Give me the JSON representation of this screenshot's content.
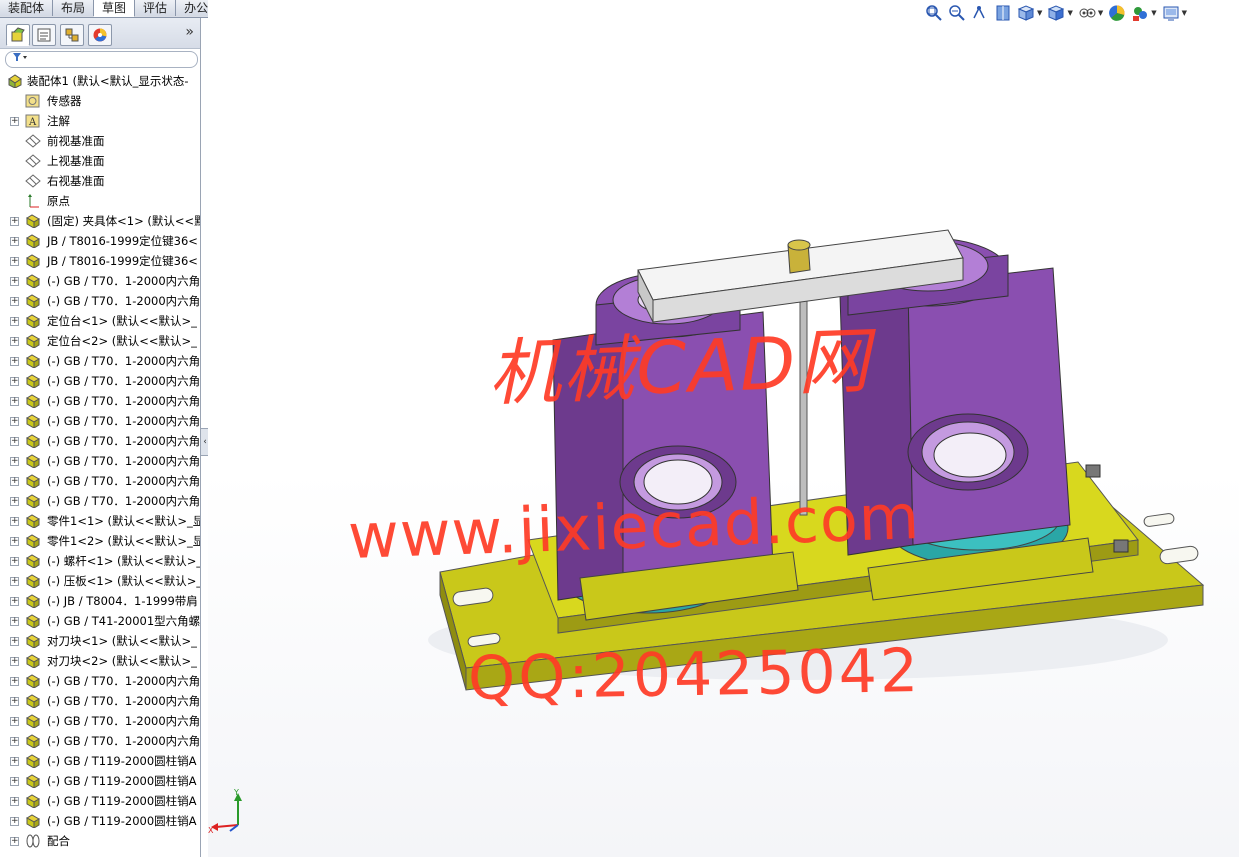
{
  "command_tabs": [
    {
      "label": "装配体",
      "active": false
    },
    {
      "label": "布局",
      "active": false
    },
    {
      "label": "草图",
      "active": true
    },
    {
      "label": "评估",
      "active": false
    },
    {
      "label": "办公室产品",
      "active": false
    }
  ],
  "panel": {
    "more_label": "»",
    "filter_icon": "filter-icon",
    "collapse_label": "‹"
  },
  "tree": {
    "root": "装配体1 (默认<默认_显示状态-",
    "items": [
      {
        "label": "传感器",
        "icon": "sensor-icon",
        "expandable": false
      },
      {
        "label": "注解",
        "icon": "annotation-icon",
        "expandable": true
      },
      {
        "label": "前视基准面",
        "icon": "plane-icon",
        "expandable": false
      },
      {
        "label": "上视基准面",
        "icon": "plane-icon",
        "expandable": false
      },
      {
        "label": "右视基准面",
        "icon": "plane-icon",
        "expandable": false
      },
      {
        "label": "原点",
        "icon": "origin-icon",
        "expandable": false
      },
      {
        "label": "(固定) 夹具体<1> (默认<<默",
        "icon": "part-icon",
        "expandable": true
      },
      {
        "label": "JB / T8016-1999定位键36<",
        "icon": "part-icon",
        "expandable": true
      },
      {
        "label": "JB / T8016-1999定位键36<",
        "icon": "part-icon",
        "expandable": true
      },
      {
        "label": "(-) GB / T70．1-2000内六角",
        "icon": "part-icon",
        "expandable": true
      },
      {
        "label": "(-) GB / T70．1-2000内六角",
        "icon": "part-icon",
        "expandable": true
      },
      {
        "label": "定位台<1> (默认<<默认>_",
        "icon": "part-icon",
        "expandable": true
      },
      {
        "label": "定位台<2> (默认<<默认>_",
        "icon": "part-icon",
        "expandable": true
      },
      {
        "label": "(-) GB / T70．1-2000内六角",
        "icon": "part-icon",
        "expandable": true
      },
      {
        "label": "(-) GB / T70．1-2000内六角",
        "icon": "part-icon",
        "expandable": true
      },
      {
        "label": "(-) GB / T70．1-2000内六角",
        "icon": "part-icon",
        "expandable": true
      },
      {
        "label": "(-) GB / T70．1-2000内六角",
        "icon": "part-icon",
        "expandable": true
      },
      {
        "label": "(-) GB / T70．1-2000内六角",
        "icon": "part-icon",
        "expandable": true
      },
      {
        "label": "(-) GB / T70．1-2000内六角",
        "icon": "part-icon",
        "expandable": true
      },
      {
        "label": "(-) GB / T70．1-2000内六角",
        "icon": "part-icon",
        "expandable": true
      },
      {
        "label": "(-) GB / T70．1-2000内六角",
        "icon": "part-icon",
        "expandable": true
      },
      {
        "label": "零件1<1> (默认<<默认>_显",
        "icon": "part-icon",
        "expandable": true
      },
      {
        "label": "零件1<2> (默认<<默认>_显",
        "icon": "part-icon",
        "expandable": true
      },
      {
        "label": "(-) 螺杆<1> (默认<<默认>_",
        "icon": "part-icon",
        "expandable": true
      },
      {
        "label": "(-) 压板<1> (默认<<默认>_",
        "icon": "part-icon",
        "expandable": true
      },
      {
        "label": "(-) JB / T8004．1-1999带肩",
        "icon": "part-icon",
        "expandable": true
      },
      {
        "label": "(-) GB / T41-20001型六角螺",
        "icon": "part-icon",
        "expandable": true
      },
      {
        "label": "对刀块<1> (默认<<默认>_",
        "icon": "part-icon",
        "expandable": true
      },
      {
        "label": "对刀块<2> (默认<<默认>_",
        "icon": "part-icon",
        "expandable": true
      },
      {
        "label": "(-) GB / T70．1-2000内六角",
        "icon": "part-icon",
        "expandable": true
      },
      {
        "label": "(-) GB / T70．1-2000内六角",
        "icon": "part-icon",
        "expandable": true
      },
      {
        "label": "(-) GB / T70．1-2000内六角",
        "icon": "part-icon",
        "expandable": true
      },
      {
        "label": "(-) GB / T70．1-2000内六角",
        "icon": "part-icon",
        "expandable": true
      },
      {
        "label": "(-) GB / T119-2000圆柱销A",
        "icon": "part-icon",
        "expandable": true
      },
      {
        "label": "(-) GB / T119-2000圆柱销A",
        "icon": "part-icon",
        "expandable": true
      },
      {
        "label": "(-) GB / T119-2000圆柱销A",
        "icon": "part-icon",
        "expandable": true
      },
      {
        "label": "(-) GB / T119-2000圆柱销A",
        "icon": "part-icon",
        "expandable": true
      },
      {
        "label": "配合",
        "icon": "mates-icon",
        "expandable": true
      }
    ]
  },
  "view_toolbar": [
    {
      "icon": "zoom-to-fit-icon",
      "dropdown": false
    },
    {
      "icon": "zoom-area-icon",
      "dropdown": false
    },
    {
      "icon": "previous-view-icon",
      "dropdown": false
    },
    {
      "icon": "section-view-icon",
      "dropdown": false
    },
    {
      "icon": "view-orientation-icon",
      "dropdown": true
    },
    {
      "icon": "display-style-icon",
      "dropdown": true
    },
    {
      "icon": "hide-show-items-icon",
      "dropdown": true
    },
    {
      "icon": "edit-appearance-icon",
      "dropdown": false
    },
    {
      "icon": "apply-scene-icon",
      "dropdown": true
    },
    {
      "icon": "view-settings-icon",
      "dropdown": true
    }
  ],
  "watermark": {
    "line1": "机械CAD网",
    "line2": "www.jixiecad.com",
    "line3": "QQ:20425042",
    "color": "#ff3b26"
  },
  "triad": {
    "x_label": "X",
    "y_label": "Y"
  },
  "colors": {
    "fixture_body": "#8a4fb0",
    "base_plate": "#d8d81e",
    "locating_ring": "#2aa6a6",
    "clamp_plate": "#f2f2f2"
  }
}
